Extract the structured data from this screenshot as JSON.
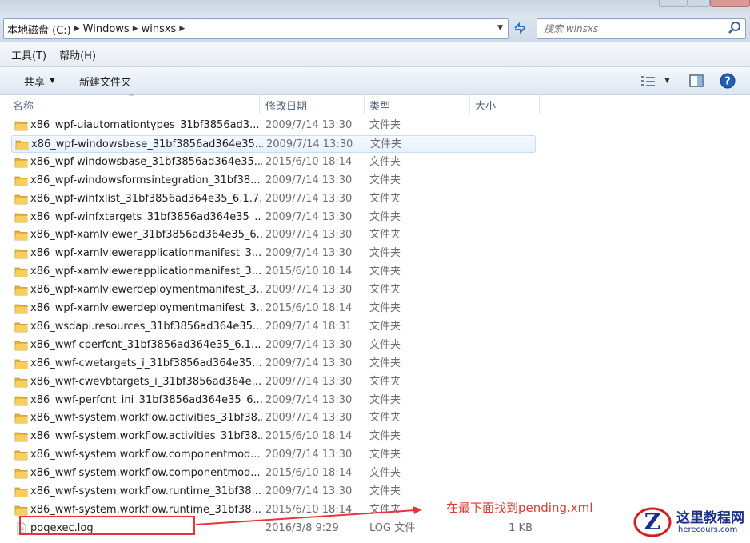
{
  "address": {
    "crumbs": [
      "本地磁盘 (C:)",
      "Windows",
      "winsxs"
    ],
    "search_placeholder": "搜索 winsxs"
  },
  "menu": [
    "工具(T)",
    "帮助(H)"
  ],
  "toolbar": {
    "share_label": "共享",
    "new_folder_label": "新建文件夹"
  },
  "columns": {
    "name": "名称",
    "date": "修改日期",
    "type": "类型",
    "size": "大小"
  },
  "icons": {
    "folder": "folder-icon",
    "file": "file-icon",
    "refresh": "refresh-icon",
    "search": "search-icon",
    "view": "view-options-icon",
    "preview": "preview-pane-icon",
    "help": "help-icon"
  },
  "colors": {
    "annotation": "#e23a2f",
    "folder": "#f3c44d",
    "help_blue": "#1f5fb4"
  },
  "files": [
    {
      "name": "x86_wpf-uiautomationtypes_31bf3856ad3...",
      "date": "2009/7/14 13:30",
      "type": "文件夹",
      "size": "",
      "kind": "folder"
    },
    {
      "name": "x86_wpf-windowsbase_31bf3856ad364e35...",
      "date": "2009/7/14 13:30",
      "type": "文件夹",
      "size": "",
      "kind": "folder",
      "highlighted": true
    },
    {
      "name": "x86_wpf-windowsbase_31bf3856ad364e35...",
      "date": "2015/6/10 18:14",
      "type": "文件夹",
      "size": "",
      "kind": "folder"
    },
    {
      "name": "x86_wpf-windowsformsintegration_31bf38...",
      "date": "2009/7/14 13:30",
      "type": "文件夹",
      "size": "",
      "kind": "folder"
    },
    {
      "name": "x86_wpf-winfxlist_31bf3856ad364e35_6.1.7...",
      "date": "2009/7/14 13:30",
      "type": "文件夹",
      "size": "",
      "kind": "folder"
    },
    {
      "name": "x86_wpf-winfxtargets_31bf3856ad364e35_...",
      "date": "2009/7/14 13:30",
      "type": "文件夹",
      "size": "",
      "kind": "folder"
    },
    {
      "name": "x86_wpf-xamlviewer_31bf3856ad364e35_6...",
      "date": "2009/7/14 13:30",
      "type": "文件夹",
      "size": "",
      "kind": "folder"
    },
    {
      "name": "x86_wpf-xamlviewerapplicationmanifest_3...",
      "date": "2009/7/14 13:30",
      "type": "文件夹",
      "size": "",
      "kind": "folder"
    },
    {
      "name": "x86_wpf-xamlviewerapplicationmanifest_3...",
      "date": "2015/6/10 18:14",
      "type": "文件夹",
      "size": "",
      "kind": "folder"
    },
    {
      "name": "x86_wpf-xamlviewerdeploymentmanifest_3...",
      "date": "2009/7/14 13:30",
      "type": "文件夹",
      "size": "",
      "kind": "folder"
    },
    {
      "name": "x86_wpf-xamlviewerdeploymentmanifest_3...",
      "date": "2015/6/10 18:14",
      "type": "文件夹",
      "size": "",
      "kind": "folder"
    },
    {
      "name": "x86_wsdapi.resources_31bf3856ad364e35...",
      "date": "2009/7/14 18:31",
      "type": "文件夹",
      "size": "",
      "kind": "folder"
    },
    {
      "name": "x86_wwf-cperfcnt_31bf3856ad364e35_6.1....",
      "date": "2009/7/14 13:30",
      "type": "文件夹",
      "size": "",
      "kind": "folder"
    },
    {
      "name": "x86_wwf-cwetargets_i_31bf3856ad364e35...",
      "date": "2009/7/14 13:30",
      "type": "文件夹",
      "size": "",
      "kind": "folder"
    },
    {
      "name": "x86_wwf-cwevbtargets_i_31bf3856ad364e...",
      "date": "2009/7/14 13:30",
      "type": "文件夹",
      "size": "",
      "kind": "folder"
    },
    {
      "name": "x86_wwf-perfcnt_ini_31bf3856ad364e35_6....",
      "date": "2009/7/14 13:30",
      "type": "文件夹",
      "size": "",
      "kind": "folder"
    },
    {
      "name": "x86_wwf-system.workflow.activities_31bf38...",
      "date": "2009/7/14 13:30",
      "type": "文件夹",
      "size": "",
      "kind": "folder"
    },
    {
      "name": "x86_wwf-system.workflow.activities_31bf38...",
      "date": "2015/6/10 18:14",
      "type": "文件夹",
      "size": "",
      "kind": "folder"
    },
    {
      "name": "x86_wwf-system.workflow.componentmod...",
      "date": "2009/7/14 13:30",
      "type": "文件夹",
      "size": "",
      "kind": "folder"
    },
    {
      "name": "x86_wwf-system.workflow.componentmod...",
      "date": "2015/6/10 18:14",
      "type": "文件夹",
      "size": "",
      "kind": "folder"
    },
    {
      "name": "x86_wwf-system.workflow.runtime_31bf38...",
      "date": "2009/7/14 13:30",
      "type": "文件夹",
      "size": "",
      "kind": "folder"
    },
    {
      "name": "x86_wwf-system.workflow.runtime_31bf38...",
      "date": "2015/6/10 18:14",
      "type": "文件夹",
      "size": "",
      "kind": "folder"
    },
    {
      "name": "poqexec.log",
      "date": "2016/3/8 9:29",
      "type": "LOG 文件",
      "size": "1 KB",
      "kind": "file"
    }
  ],
  "annotation": {
    "text": "在最下面找到pending.xml"
  },
  "watermark": {
    "title": "这里教程网",
    "url": "herecours.com"
  }
}
